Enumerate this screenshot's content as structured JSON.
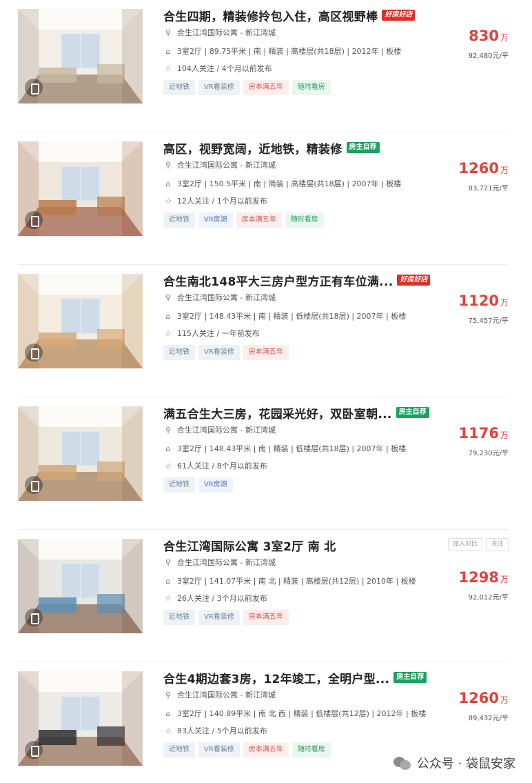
{
  "listings": [
    {
      "title": "合生四期，精装修拎包入住，高区视野棒",
      "badge": {
        "text": "好房好店",
        "kind": "hot"
      },
      "address": "合生江湾国际公寓 - 新江湾城",
      "detail": "3室2厅 | 89.75平米 | 南 | 精装 | 高楼层(共18层) | 2012年 | 板楼",
      "follow": "104人关注 / 4个月以前发布",
      "tags": [
        {
          "text": "近地铁",
          "kind": "metro"
        },
        {
          "text": "VR看装修",
          "kind": "metro"
        },
        {
          "text": "房本满五年",
          "kind": "five"
        },
        {
          "text": "随时看房",
          "kind": "anytime"
        }
      ],
      "price_total": "830",
      "price_unit": "万",
      "price_per": "92,480元/平"
    },
    {
      "title": "高区，视野宽阔，近地铁，精装修",
      "badge": {
        "text": "房主自荐",
        "kind": "owner"
      },
      "address": "合生江湾国际公寓 - 新江湾城",
      "detail": "3室2厅 | 150.5平米 | 南 | 简装 | 高楼层(共18层) | 2007年 | 板楼",
      "follow": "12人关注 / 1个月以前发布",
      "tags": [
        {
          "text": "近地铁",
          "kind": "metro"
        },
        {
          "text": "VR房源",
          "kind": "vr"
        },
        {
          "text": "房本满五年",
          "kind": "five"
        },
        {
          "text": "随时看房",
          "kind": "anytime"
        }
      ],
      "price_total": "1260",
      "price_unit": "万",
      "price_per": "83,721元/平"
    },
    {
      "title": "合生南北148平大三房户型方正有车位满...",
      "badge": {
        "text": "好房好店",
        "kind": "hot"
      },
      "address": "合生江湾国际公寓 - 新江湾城",
      "detail": "3室2厅 | 148.43平米 | 南 | 精装 | 低楼层(共18层) | 2007年 | 板楼",
      "follow": "115人关注 / 一年前发布",
      "tags": [
        {
          "text": "近地铁",
          "kind": "metro"
        },
        {
          "text": "VR看装修",
          "kind": "metro"
        },
        {
          "text": "房本满五年",
          "kind": "five"
        }
      ],
      "price_total": "1120",
      "price_unit": "万",
      "price_per": "75,457元/平"
    },
    {
      "title": "满五合生大三房，花园采光好，双卧室朝...",
      "badge": {
        "text": "房主自荐",
        "kind": "owner"
      },
      "address": "合生江湾国际公寓 - 新江湾城",
      "detail": "3室2厅 | 148.43平米 | 南 | 精装 | 低楼层(共18层) | 2007年 | 板楼",
      "follow": "61人关注 / 8个月以前发布",
      "tags": [
        {
          "text": "近地铁",
          "kind": "metro"
        },
        {
          "text": "VR房源",
          "kind": "vr"
        }
      ],
      "price_total": "1176",
      "price_unit": "万",
      "price_per": "79,230元/平"
    },
    {
      "title": "合生江湾国际公寓 3室2厅 南 北",
      "badge": null,
      "address": "合生江湾国际公寓 - 新江湾城",
      "detail": "3室2厅 | 141.07平米 | 南 北 | 精装 | 高楼层(共12层) | 2010年 | 板楼",
      "follow": "26人关注 / 3个月以前发布",
      "tags": [
        {
          "text": "近地铁",
          "kind": "metro"
        },
        {
          "text": "VR看装修",
          "kind": "metro"
        },
        {
          "text": "房本满五年",
          "kind": "five"
        }
      ],
      "price_total": "1298",
      "price_unit": "万",
      "price_per": "92,012元/平"
    },
    {
      "title": "合生4期边套3房，12年竣工，全明户型...",
      "badge": {
        "text": "房主自荐",
        "kind": "owner"
      },
      "address": "合生江湾国际公寓 - 新江湾城",
      "detail": "3室2厅 | 140.89平米 | 南 北 西 | 精装 | 低楼层(共12层) | 2012年 | 板楼",
      "follow": "83人关注 / 5个月以前发布",
      "tags": [
        {
          "text": "近地铁",
          "kind": "metro"
        },
        {
          "text": "VR看装修",
          "kind": "metro"
        },
        {
          "text": "房本满五年",
          "kind": "five"
        },
        {
          "text": "随时看房",
          "kind": "anytime"
        }
      ],
      "price_total": "1260",
      "price_unit": "万",
      "price_per": "89,432元/平"
    }
  ],
  "actions": {
    "compare": "加入对比",
    "follow": "关注"
  },
  "watermark": "公众号 · 袋鼠安家",
  "icons": {
    "address": "location-pin-icon",
    "detail": "house-icon",
    "follow": "star-icon"
  },
  "colors": {
    "price": "#e0433b",
    "hot_badge": "#e02e24",
    "owner_badge": "#1aa260"
  }
}
